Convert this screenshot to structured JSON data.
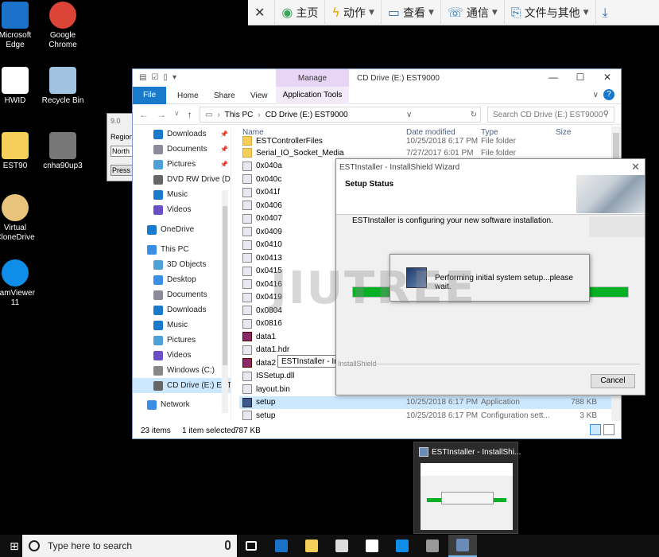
{
  "desktop": {
    "icons": [
      {
        "label_1": "Microsoft",
        "label_2": "Edge",
        "icon": "edge-icon",
        "color": "#1a73c8"
      },
      {
        "label_1": "Google",
        "label_2": "Chrome",
        "icon": "chrome-icon",
        "color": "#db4437"
      },
      {
        "label_1": "HWID",
        "label_2": "",
        "icon": "document-icon",
        "color": "#ffffff"
      },
      {
        "label_1": "Recycle Bin",
        "label_2": "",
        "icon": "recycle-bin-icon",
        "color": "#9fc3e0"
      },
      {
        "label_1": "EST90",
        "label_2": "",
        "icon": "folder-icon",
        "color": "#f5cf5a"
      },
      {
        "label_1": "cnha90up3",
        "label_2": "",
        "icon": "installer-icon",
        "color": "#777777"
      },
      {
        "label_1": "Virtual",
        "label_2": "CloneDrive",
        "icon": "sheep-icon",
        "color": "#e8c47a"
      },
      {
        "label_1": "eamViewer",
        "label_2": "11",
        "icon": "teamviewer-icon",
        "color": "#0e8ee9"
      }
    ]
  },
  "remote_toolbar": {
    "items": [
      {
        "label": "",
        "icon": "close-icon"
      },
      {
        "label": "主页",
        "icon": "home-icon"
      },
      {
        "label": "动作",
        "icon": "lightning-icon"
      },
      {
        "label": "查看",
        "icon": "monitor-icon"
      },
      {
        "label": "通信",
        "icon": "phone-icon"
      },
      {
        "label": "文件与其他",
        "icon": "file-transfer-icon"
      },
      {
        "label": "",
        "icon": "download-icon"
      }
    ]
  },
  "region_dialog": {
    "line1": "Region",
    "line2": "North",
    "line3": "Press"
  },
  "explorer": {
    "title": "CD Drive (E:) EST9000",
    "manage_tab": "Manage",
    "ribbon": {
      "file": "File",
      "home": "Home",
      "share": "Share",
      "view": "View",
      "app_tools": "Application Tools"
    },
    "address": {
      "this_pc": "This PC",
      "drive": "CD Drive (E:) EST9000"
    },
    "search_placeholder": "Search CD Drive (E:) EST9000",
    "nav_items": [
      {
        "label": "Downloads",
        "pinned": true
      },
      {
        "label": "Documents",
        "pinned": true
      },
      {
        "label": "Pictures",
        "pinned": true
      },
      {
        "label": "DVD RW Drive (D",
        "pinned": false
      },
      {
        "label": "Music",
        "pinned": false
      },
      {
        "label": "Videos",
        "pinned": false
      },
      {
        "label": "OneDrive",
        "pinned": false
      },
      {
        "label": "This PC",
        "pinned": false
      },
      {
        "label": "3D Objects",
        "pinned": false
      },
      {
        "label": "Desktop",
        "pinned": false
      },
      {
        "label": "Documents",
        "pinned": false
      },
      {
        "label": "Downloads",
        "pinned": false
      },
      {
        "label": "Music",
        "pinned": false
      },
      {
        "label": "Pictures",
        "pinned": false
      },
      {
        "label": "Videos",
        "pinned": false
      },
      {
        "label": "Windows (C:)",
        "pinned": false
      },
      {
        "label": "CD Drive (E:) EST",
        "pinned": false
      },
      {
        "label": "Network",
        "pinned": false
      }
    ],
    "columns": {
      "name": "Name",
      "date": "Date modified",
      "type": "Type",
      "size": "Size"
    },
    "files": [
      {
        "name": "ESTControllerFiles",
        "date": "10/25/2018 6:17 PM",
        "type": "File folder",
        "size": "",
        "kind": "folder"
      },
      {
        "name": "Serial_IO_Socket_Media",
        "date": "7/27/2017 6:01 PM",
        "type": "File folder",
        "size": "",
        "kind": "folder"
      },
      {
        "name": "0x040a",
        "date": "",
        "type": "",
        "size": "",
        "kind": "cfg"
      },
      {
        "name": "0x040c",
        "date": "",
        "type": "",
        "size": "",
        "kind": "cfg"
      },
      {
        "name": "0x041f",
        "date": "",
        "type": "",
        "size": "",
        "kind": "cfg"
      },
      {
        "name": "0x0406",
        "date": "",
        "type": "",
        "size": "",
        "kind": "cfg"
      },
      {
        "name": "0x0407",
        "date": "",
        "type": "",
        "size": "",
        "kind": "cfg"
      },
      {
        "name": "0x0409",
        "date": "",
        "type": "",
        "size": "",
        "kind": "cfg"
      },
      {
        "name": "0x0410",
        "date": "",
        "type": "",
        "size": "",
        "kind": "cfg"
      },
      {
        "name": "0x0413",
        "date": "",
        "type": "",
        "size": "",
        "kind": "cfg"
      },
      {
        "name": "0x0415",
        "date": "",
        "type": "",
        "size": "",
        "kind": "cfg"
      },
      {
        "name": "0x0416",
        "date": "",
        "type": "",
        "size": "",
        "kind": "cfg"
      },
      {
        "name": "0x0419",
        "date": "",
        "type": "",
        "size": "",
        "kind": "cfg"
      },
      {
        "name": "0x0804",
        "date": "",
        "type": "",
        "size": "",
        "kind": "cfg"
      },
      {
        "name": "0x0816",
        "date": "",
        "type": "",
        "size": "",
        "kind": "cfg"
      },
      {
        "name": "data1",
        "date": "",
        "type": "",
        "size": "",
        "kind": "rar"
      },
      {
        "name": "data1.hdr",
        "date": "",
        "type": "",
        "size": "",
        "kind": "cfg"
      },
      {
        "name": "data2",
        "date": "",
        "type": "",
        "size": "",
        "kind": "rar"
      },
      {
        "name": "ISSetup.dll",
        "date": "",
        "type": "",
        "size": "",
        "kind": "cfg"
      },
      {
        "name": "layout.bin",
        "date": "",
        "type": "",
        "size": "",
        "kind": "cfg"
      },
      {
        "name": "setup",
        "date": "10/25/2018 6:17 PM",
        "type": "Application",
        "size": "788 KB",
        "kind": "app"
      },
      {
        "name": "setup",
        "date": "10/25/2018 6:17 PM",
        "type": "Configuration sett...",
        "size": "3 KB",
        "kind": "cfg"
      }
    ],
    "status": {
      "count": "23 items",
      "selected": "1 item selected",
      "size": "787 KB"
    },
    "tooltip": "ESTInstaller - InstallShield Wizard"
  },
  "wizard": {
    "title": "ESTInstaller - InstallShield Wizard",
    "heading": "Setup Status",
    "message": "ESTInstaller is configuring your new software installation.",
    "popup_text": "Performing initial system setup...please wait.",
    "progress": 1.0,
    "footer": "InstallShield",
    "cancel": "Cancel"
  },
  "watermark": "JIUTREE",
  "thumbnail": {
    "title": "ESTInstaller - InstallShi..."
  },
  "taskbar": {
    "search_placeholder": "Type here to search",
    "apps": [
      {
        "icon": "task-view-icon",
        "color": "#ffffff"
      },
      {
        "icon": "edge-icon",
        "color": "#1a73c8"
      },
      {
        "icon": "file-explorer-icon",
        "color": "#f5cf5a"
      },
      {
        "icon": "store-icon",
        "color": "#dddddd"
      },
      {
        "icon": "mail-icon",
        "color": "#ffffff"
      },
      {
        "icon": "teamviewer-icon",
        "color": "#0e8ee9"
      },
      {
        "icon": "installer-icon",
        "color": "#999999"
      },
      {
        "icon": "installshield-icon",
        "color": "#6a8ab8"
      }
    ]
  }
}
